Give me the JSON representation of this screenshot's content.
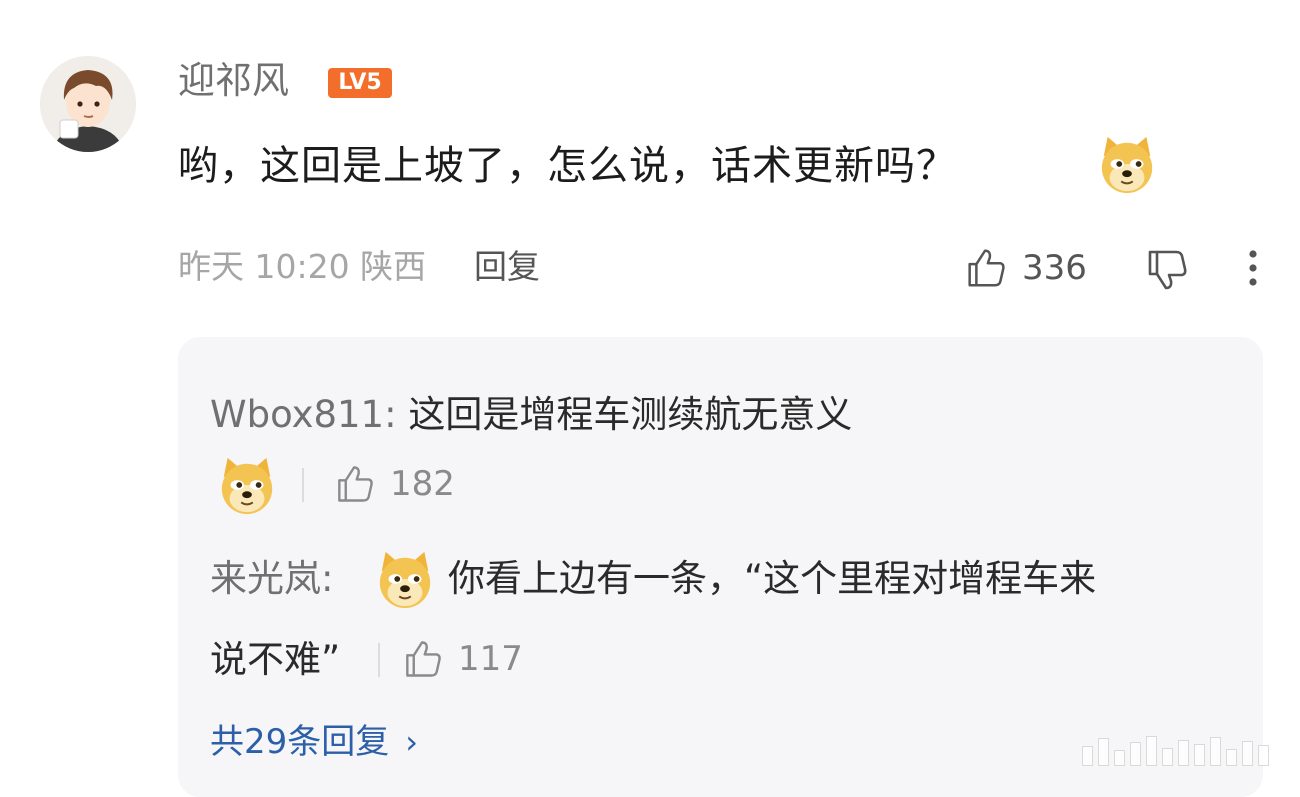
{
  "comment": {
    "username": "迎祁风",
    "level_badge": "LV5",
    "text": "哟，这回是上坡了，怎么说，话术更新吗？",
    "emoji_icon": "doge-emoji",
    "time": "昨天 10:20 陕西",
    "reply_label": "回复",
    "like_count": "336"
  },
  "replies": [
    {
      "author": "Wbox811:",
      "text": "这回是增程车测续航无意义",
      "emoji_icon": "doge-emoji",
      "like_count": "182"
    },
    {
      "author": "来光岚:",
      "emoji_icon": "doge-emoji",
      "text_line1": "你看上边有一条，“这个里程对增程车来",
      "text_line2": "说不难”",
      "like_count": "117"
    }
  ],
  "replies_more": {
    "label": "共29条回复",
    "chevron": "›"
  },
  "colors": {
    "level_badge": "#f26e2a",
    "link_blue": "#2c5fa8",
    "reply_box_bg": "#f6f6f8"
  }
}
